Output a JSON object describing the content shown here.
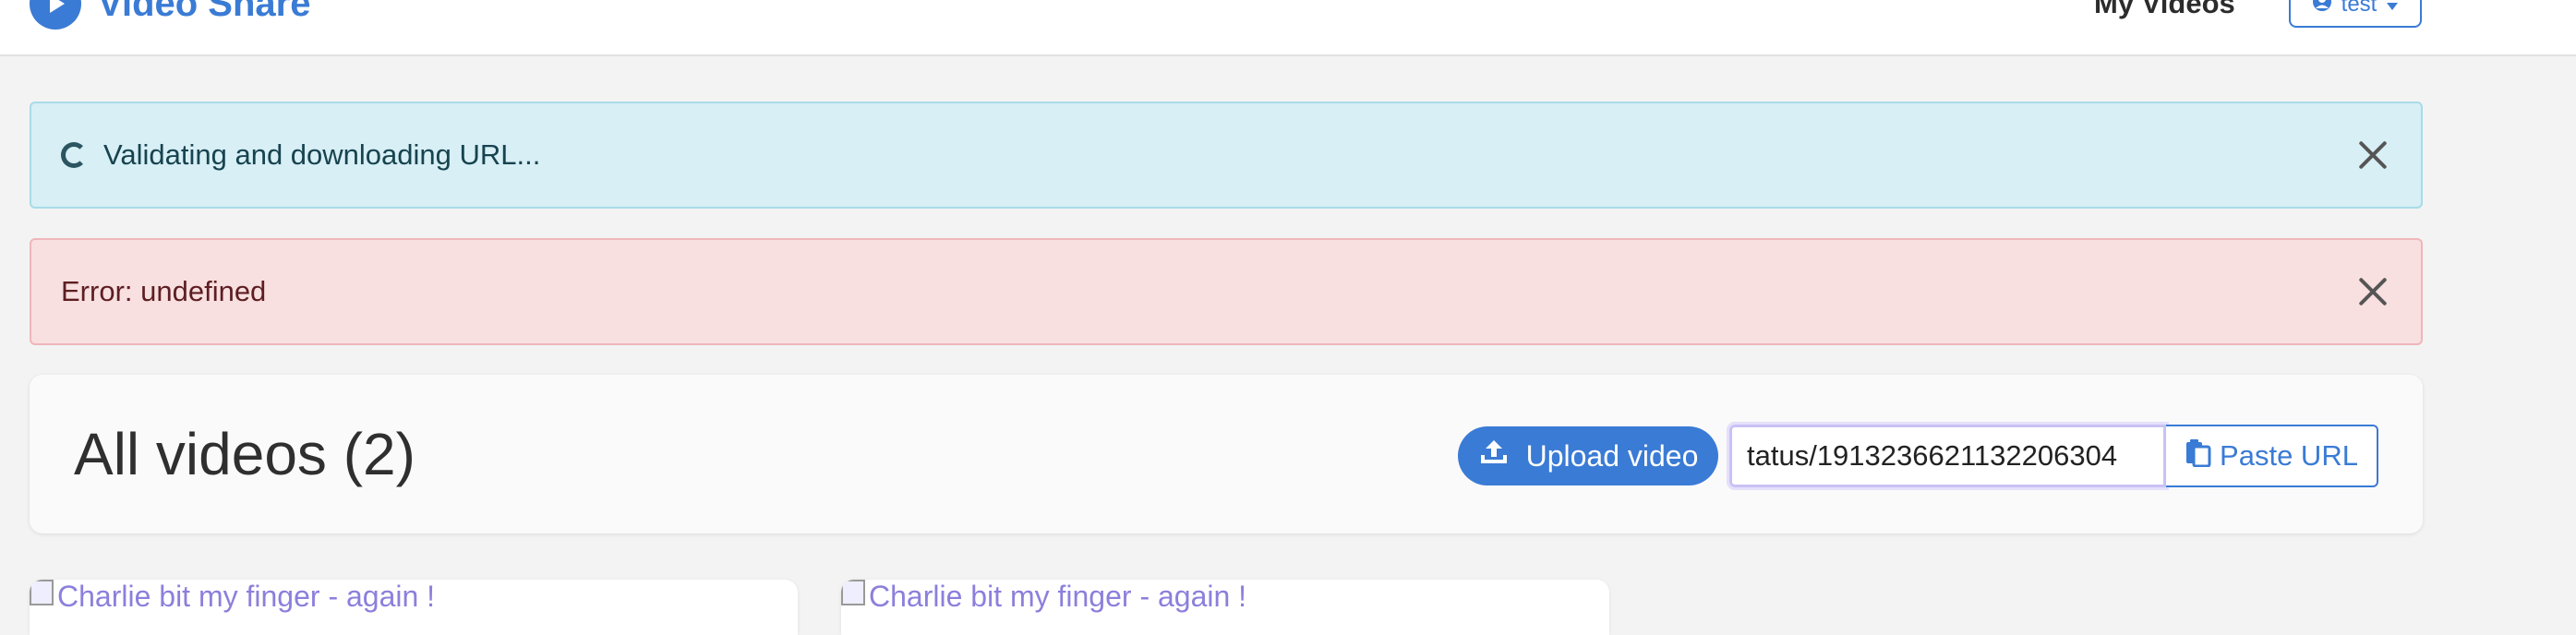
{
  "navbar": {
    "brand": "Video Share",
    "my_videos": "My Videos",
    "user": "test"
  },
  "alerts": {
    "info_text": "Validating and downloading URL...",
    "error_text": "Error: undefined"
  },
  "header": {
    "title": "All videos (2)",
    "upload_label": "Upload video",
    "url_value": "tatus/1913236621132206304",
    "paste_label": "Paste URL"
  },
  "videos": [
    {
      "alt": "Charlie bit my finger - again !"
    },
    {
      "alt": "Charlie bit my finger - again !"
    }
  ],
  "colors": {
    "accent": "#3a7bd5",
    "info_bg": "#d7eff5",
    "danger_bg": "#f8dfe0"
  }
}
